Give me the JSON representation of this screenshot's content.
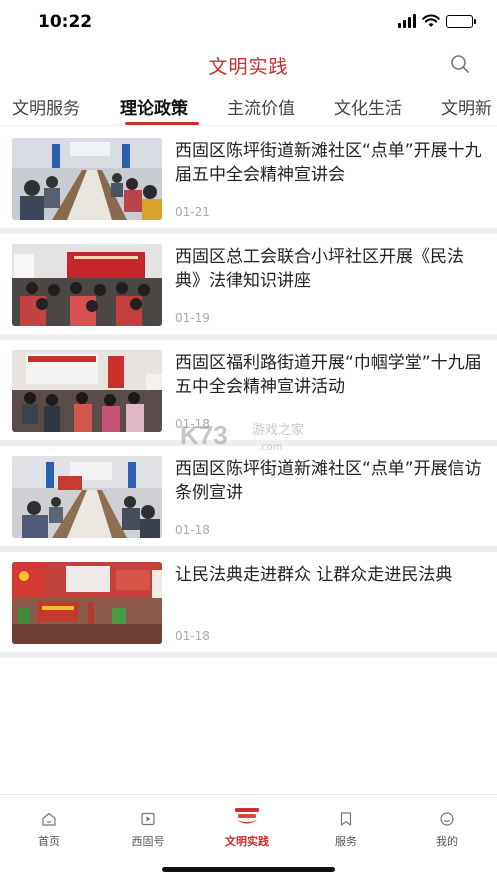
{
  "status": {
    "time": "10:22"
  },
  "header": {
    "title": "文明实践"
  },
  "tabs": [
    {
      "label": "文明服务",
      "active": false
    },
    {
      "label": "理论政策",
      "active": true
    },
    {
      "label": "主流价值",
      "active": false
    },
    {
      "label": "文化生活",
      "active": false
    },
    {
      "label": "文明新",
      "active": false
    }
  ],
  "news": [
    {
      "title": "西固区陈坪街道新滩社区“点单”开展十九届五中全会精神宣讲会",
      "date": "01-21"
    },
    {
      "title": "西固区总工会联合小坪社区开展《民法典》法律知识讲座",
      "date": "01-19"
    },
    {
      "title": "西固区福利路街道开展“巾帼学堂”十九届五中全会精神宣讲活动",
      "date": "01-18"
    },
    {
      "title": "西固区陈坪街道新滩社区“点单”开展信访条例宣讲",
      "date": "01-18"
    },
    {
      "title": "让民法典走进群众 让群众走进民法典",
      "date": "01-18"
    }
  ],
  "watermark": {
    "brand": "K73",
    "text": "游戏之家",
    "url": ".com"
  },
  "tabbar": [
    {
      "label": "首页",
      "icon": "home-icon",
      "active": false
    },
    {
      "label": "西固号",
      "icon": "video-icon",
      "active": false
    },
    {
      "label": "文明实践",
      "icon": "practice-icon",
      "active": true
    },
    {
      "label": "服务",
      "icon": "bookmark-icon",
      "active": false
    },
    {
      "label": "我的",
      "icon": "profile-icon",
      "active": false
    }
  ],
  "colors": {
    "accent": "#c8302a",
    "divider": "#efefef"
  }
}
